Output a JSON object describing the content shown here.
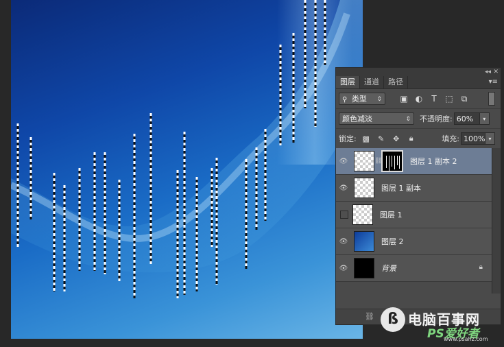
{
  "panel": {
    "tabs": [
      {
        "label": "图层",
        "active": true
      },
      {
        "label": "通道",
        "active": false
      },
      {
        "label": "路径",
        "active": false
      }
    ],
    "filter": {
      "kind_label": "类型",
      "search_icon": "search-icon",
      "icons": [
        "image-filter-icon",
        "adjustment-filter-icon",
        "type-filter-icon",
        "shape-filter-icon",
        "smartobject-filter-icon"
      ]
    },
    "blend_mode": "颜色减淡",
    "opacity_label": "不透明度:",
    "opacity_value": "60%",
    "lock_label": "锁定:",
    "lock_icons": [
      "lock-transparent-icon",
      "lock-paint-icon",
      "lock-move-icon",
      "lock-all-icon"
    ],
    "fill_label": "填充:",
    "fill_value": "100%",
    "layers": [
      {
        "name": "图层 1 副本 2",
        "visible": true,
        "selected": true,
        "thumb": "transparent",
        "has_mask": true
      },
      {
        "name": "图层 1 副本",
        "visible": true,
        "selected": false,
        "thumb": "transparent",
        "has_mask": false
      },
      {
        "name": "图层 1",
        "visible": false,
        "selected": false,
        "thumb": "transparent",
        "has_mask": false
      },
      {
        "name": "图层 2",
        "visible": true,
        "selected": false,
        "thumb": "blue",
        "has_mask": false
      },
      {
        "name": "背景",
        "visible": true,
        "selected": false,
        "thumb": "black",
        "has_mask": false,
        "locked": true
      }
    ]
  },
  "watermark": {
    "text": "电脑百事网",
    "ps": "PS爱好者",
    "url": "www.psahz.com"
  },
  "colors": {
    "panel_bg": "#4a4a4a",
    "selected_layer": "#6d7d95",
    "canvas_deep": "#0b2a78",
    "canvas_light": "#6ab5e6"
  }
}
